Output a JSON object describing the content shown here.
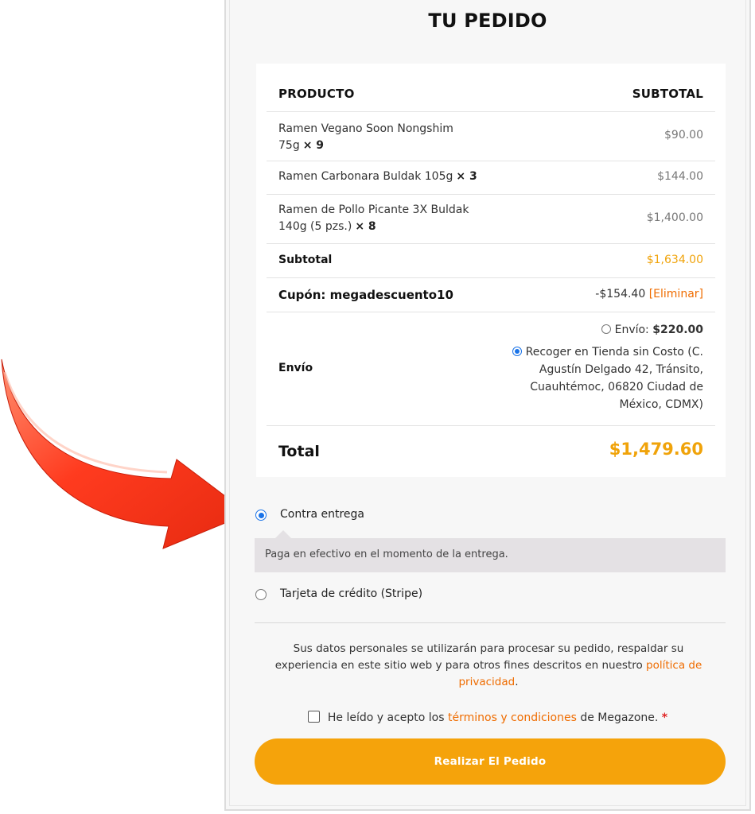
{
  "order": {
    "title": "TU PEDIDO",
    "header": {
      "product": "PRODUCTO",
      "subtotal": "SUBTOTAL"
    },
    "items": [
      {
        "name_line1": "Ramen Vegano Soon Nongshim",
        "name_line2": "75g",
        "qty": "× 9",
        "price": "$90.00"
      },
      {
        "name_line1": "Ramen Carbonara Buldak 105g",
        "name_line2": "",
        "qty": "× 3",
        "price": "$144.00"
      },
      {
        "name_line1": "Ramen de Pollo Picante 3X Buldak",
        "name_line2": "140g (5 pzs.)",
        "qty": "× 8",
        "price": "$1,400.00"
      }
    ],
    "subtotal": {
      "label": "Subtotal",
      "value": "$1,634.00"
    },
    "coupon": {
      "label": "Cupón: megadescuento10",
      "value": "-$154.40",
      "remove": "[Eliminar]"
    },
    "shipping": {
      "label": "Envío",
      "option_ship_label": "Envío:",
      "option_ship_price": "$220.00",
      "pickup_line1": "Recoger en Tienda sin Costo (C.",
      "pickup_line2": "Agustín Delgado 42, Tránsito,",
      "pickup_line3": "Cuauhtémoc, 06820 Ciudad de",
      "pickup_line4": "México, CDMX)"
    },
    "total": {
      "label": "Total",
      "value": "$1,479.60"
    }
  },
  "payment": {
    "cod_label": "Contra entrega",
    "cod_description": "Paga en efectivo en el momento de la entrega.",
    "card_label": "Tarjeta de crédito (Stripe)",
    "selected": "cod"
  },
  "privacy": {
    "text": "Sus datos personales se utilizarán para procesar su pedido, respaldar su experiencia en este sitio web y para otros fines descritos en nuestro",
    "link": "política de privacidad",
    "end": "."
  },
  "terms": {
    "prefix": "He leído y acepto los",
    "link": "términos y condiciones",
    "suffix": "de Megazone.",
    "required_mark": "*"
  },
  "place_order_label": "Realizar El Pedido",
  "colors": {
    "accent": "#f5a30b",
    "link": "#ef6c00",
    "arrow": "#ff3b1f",
    "radio": "#1a73e8"
  }
}
